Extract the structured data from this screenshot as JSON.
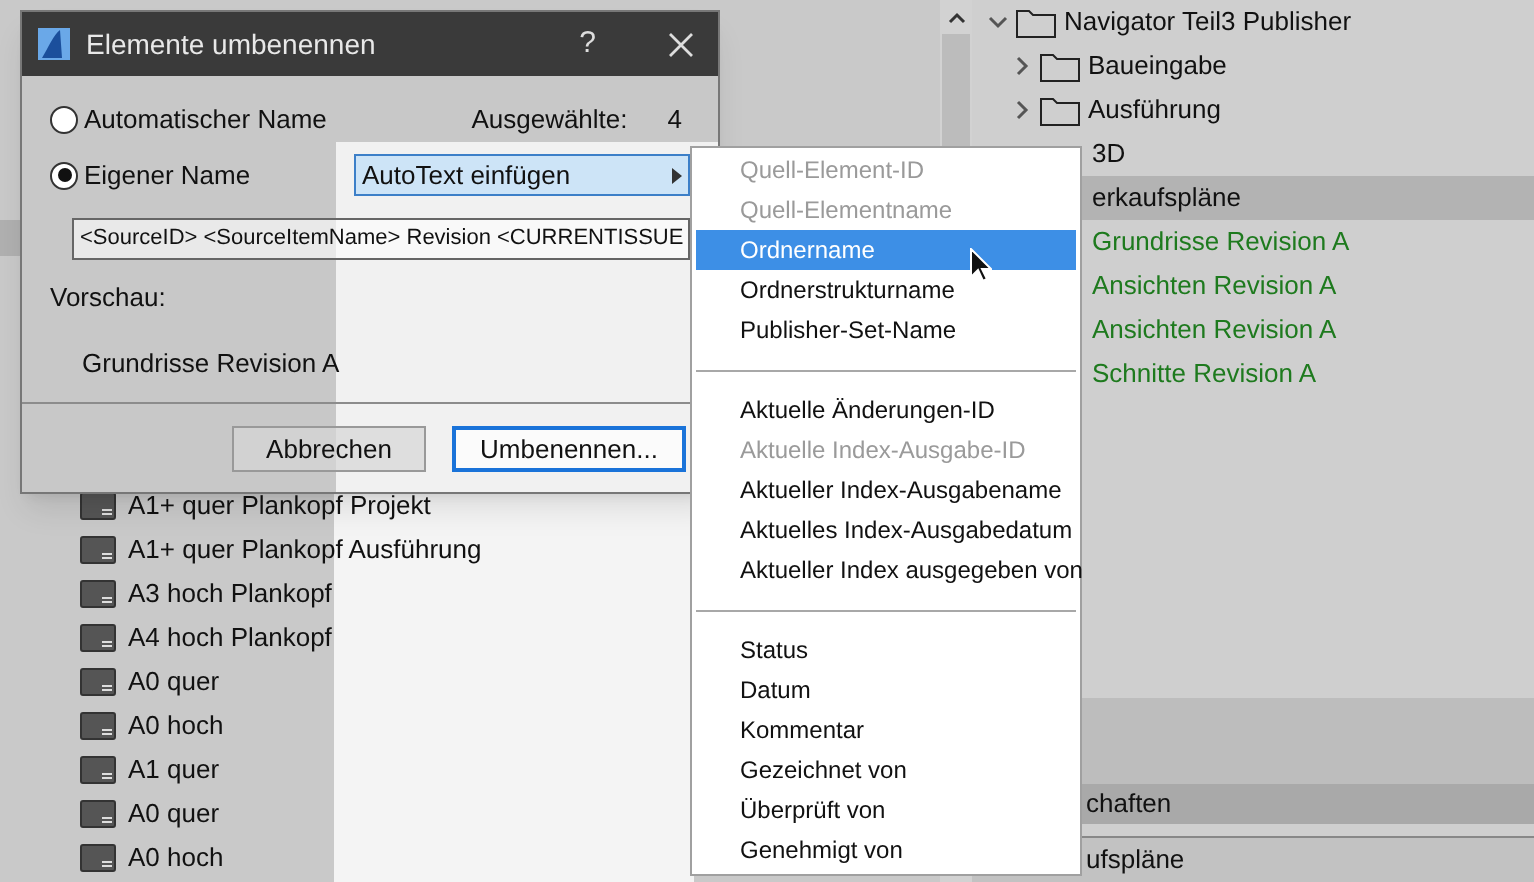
{
  "layouts": [
    "A1+ quer Plankopf Projekt",
    "A1+ quer Plankopf Ausführung",
    "A3 hoch Plankopf",
    "A4 hoch Plankopf",
    "A0 quer",
    "A0 hoch",
    "A1 quer",
    "A0 quer",
    "A0 hoch"
  ],
  "tree": [
    {
      "label": "Navigator Teil3 Publisher",
      "kind": "folder",
      "expanded": true,
      "children": [
        {
          "label": "Baueingabe",
          "kind": "folder",
          "expanded": false,
          "selected": false
        },
        {
          "label": "Ausführung",
          "kind": "folder",
          "expanded": false,
          "selected": false
        },
        {
          "label": "3D",
          "kind": "partial",
          "selected": false
        },
        {
          "label": "erkaufspläne",
          "kind": "partial",
          "selected": true,
          "children": [
            {
              "label": "Grundrisse Revision A",
              "kind": "set",
              "selected": false
            },
            {
              "label": "Ansichten Revision A",
              "kind": "set",
              "selected": false
            },
            {
              "label": "Ansichten Revision A",
              "kind": "set",
              "selected": false
            },
            {
              "label": "Schnitte Revision A",
              "kind": "set",
              "selected": false
            }
          ]
        }
      ]
    }
  ],
  "bottom_panels": [
    {
      "label": "chaften",
      "kind": "header"
    },
    {
      "label": "ufspläne",
      "kind": "row"
    }
  ],
  "dialog": {
    "title": "Elemente umbenennen",
    "help": "?",
    "options": [
      {
        "label": "Automatischer Name",
        "selected": false
      },
      {
        "label": "Eigener Name",
        "selected": true
      }
    ],
    "count_label": "Ausgewählte:",
    "count_value": "4",
    "autotext_button": "AutoText einfügen",
    "name_field": "<SourceID> <SourceItemName> Revision <CURRENTISSUE",
    "preview_label": "Vorschau:",
    "preview_value": "Grundrisse Revision A",
    "buttons": [
      {
        "label": "Abbrechen",
        "kind": "normal"
      },
      {
        "label": "Umbenennen...",
        "kind": "default"
      }
    ]
  },
  "menu": [
    [
      {
        "label": "Quell-Element-ID",
        "disabled": true,
        "selected": false
      },
      {
        "label": "Quell-Elementname",
        "disabled": true,
        "selected": false
      },
      {
        "label": "Ordnername",
        "disabled": false,
        "selected": true
      },
      {
        "label": "Ordnerstrukturname",
        "disabled": false,
        "selected": false
      },
      {
        "label": "Publisher-Set-Name",
        "disabled": false,
        "selected": false
      }
    ],
    [
      {
        "label": "Aktuelle Änderungen-ID",
        "disabled": false,
        "selected": false
      },
      {
        "label": "Aktuelle Index-Ausgabe-ID",
        "disabled": true,
        "selected": false
      },
      {
        "label": "Aktueller Index-Ausgabename",
        "disabled": false,
        "selected": false
      },
      {
        "label": "Aktuelles Index-Ausgabedatum",
        "disabled": false,
        "selected": false
      },
      {
        "label": "Aktueller Index ausgegeben von",
        "disabled": false,
        "selected": false
      }
    ],
    [
      {
        "label": "Status",
        "disabled": false,
        "selected": false
      },
      {
        "label": "Datum",
        "disabled": false,
        "selected": false
      },
      {
        "label": "Kommentar",
        "disabled": false,
        "selected": false
      },
      {
        "label": "Gezeichnet von",
        "disabled": false,
        "selected": false
      },
      {
        "label": "Überprüft von",
        "disabled": false,
        "selected": false
      },
      {
        "label": "Genehmigt von",
        "disabled": false,
        "selected": false
      }
    ]
  ]
}
